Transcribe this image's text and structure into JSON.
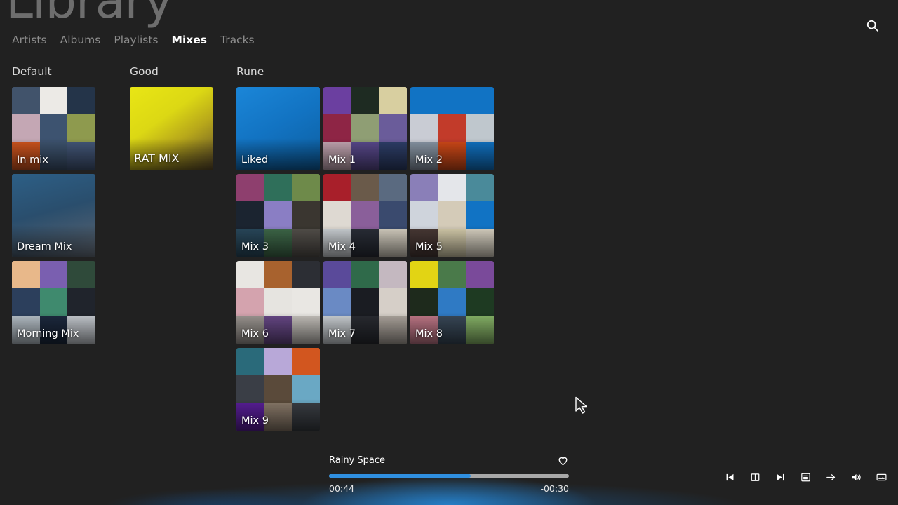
{
  "header": {
    "title": "Library",
    "search_icon": "search-icon",
    "tabs": [
      {
        "label": "Artists",
        "active": false
      },
      {
        "label": "Albums",
        "active": false
      },
      {
        "label": "Playlists",
        "active": false
      },
      {
        "label": "Mixes",
        "active": true
      },
      {
        "label": "Tracks",
        "active": false
      }
    ]
  },
  "sections": [
    {
      "name": "Default",
      "tiles": [
        {
          "label": "In mix",
          "kind": "collage",
          "cells": [
            "#41536b",
            "#eceae6",
            "#243449",
            "#c4a7b4",
            "#3d5370",
            "#8e9a4e",
            "#d2561f",
            "#3e5470",
            "#44587a"
          ]
        },
        {
          "label": "Dream Mix",
          "kind": "solid",
          "color": "#2b4f6e",
          "gradient": "linear-gradient(165deg,#2d5f86 0%,#2a4e6d 45%,#4a5c6e 78%,#6b7480 100%)"
        },
        {
          "label": "Morning Mix",
          "kind": "collage",
          "cells": [
            "#e8b88a",
            "#7a5fb0",
            "#2f4a3a",
            "#2c3f5c",
            "#3f8a6e",
            "#20242c",
            "#b9c3cb",
            "#1d2a40",
            "#c9ced4"
          ]
        }
      ]
    },
    {
      "name": "Good",
      "tiles": [
        {
          "label": "RAT MIX",
          "kind": "solid",
          "color": "#e3e018",
          "gradient": "linear-gradient(145deg,#e9e615 0%,#dcd814 38%,#b8a81a 62%,#5c4a2a 100%)"
        }
      ]
    },
    {
      "name": "Rune",
      "tiles": [
        {
          "label": "Liked",
          "kind": "solid",
          "color": "#1173c4",
          "gradient": "linear-gradient(150deg,#1b86d8 0%,#1273c2 48%,#0d5e9f 100%)"
        },
        {
          "label": "Mix 1",
          "kind": "collage",
          "cells": [
            "#6b3fa0",
            "#1e2b22",
            "#d8cfa0",
            "#8e2545",
            "#8f9e74",
            "#6a5c9a",
            "#c6a8b4",
            "#5a4a8e",
            "#2e3f6a"
          ]
        },
        {
          "label": "Mix 2",
          "kind": "collage",
          "cells": [
            "#1173c4",
            "#1173c4",
            "#1173c4",
            "#c9ccd4",
            "#c23b2a",
            "#bfc7cd",
            "#8a97a6",
            "#d24a18",
            "#1173c4"
          ]
        },
        {
          "label": "Mix 3",
          "kind": "collage",
          "cells": [
            "#8e3f6e",
            "#2f6f5a",
            "#6e8a4a",
            "#1b2430",
            "#8a7ec4",
            "#3a3630",
            "#2a4a5e",
            "#3f6a4a",
            "#55514c"
          ]
        },
        {
          "label": "Mix 4",
          "kind": "collage",
          "cells": [
            "#a81f2a",
            "#6a5a4a",
            "#5a6a80",
            "#ded9d2",
            "#8a5f9a",
            "#3a4a6e",
            "#cfd4d8",
            "#2a2e38",
            "#d8d2c4"
          ]
        },
        {
          "label": "Mix 5",
          "kind": "collage",
          "cells": [
            "#8a7fb8",
            "#e4e6ea",
            "#4a8a9a",
            "#cfd4dc",
            "#d4cbb8",
            "#1173c4",
            "#4a3a36",
            "#d8cfae",
            "#ddd6c6"
          ]
        },
        {
          "label": "Mix 6",
          "kind": "collage",
          "cells": [
            "#e8e6e2",
            "#a8622e",
            "#2c2e34",
            "#d4a3ae",
            "#e6e4e0",
            "#e9e7e3",
            "#a09a94",
            "#6a4a8a",
            "#c8c4be"
          ]
        },
        {
          "label": "Mix 7",
          "kind": "collage",
          "cells": [
            "#5a4a9a",
            "#2f6a4a",
            "#c4b8c0",
            "#6a8ac4",
            "#1a1c22",
            "#d6cfc8",
            "#cfd4d8",
            "#2a2c32",
            "#b0a8a0"
          ]
        },
        {
          "label": "Mix 8",
          "kind": "collage",
          "cells": [
            "#e2d414",
            "#4a7a4a",
            "#7a4a9a",
            "#1e2a1c",
            "#2f7ac4",
            "#1e3a22",
            "#c47a8a",
            "#3a4a5a",
            "#8ab86a"
          ]
        },
        {
          "label": "Mix 9",
          "kind": "collage",
          "cells": [
            "#2a6a7a",
            "#b8a8d8",
            "#d2561f",
            "#3a3e46",
            "#5a4a3a",
            "#6aa8c4",
            "#5a1f9a",
            "#8a7a6a",
            "#3a3e44"
          ]
        }
      ]
    }
  ],
  "player": {
    "track_title": "Rainy Space",
    "elapsed": "00:44",
    "remaining": "-00:30",
    "progress_percent": 59,
    "fill_color": "#2f8fe0",
    "track_color": "#a8a8a8",
    "favorite_icon": "heart-outline-icon",
    "favorited": false,
    "controls": [
      {
        "name": "previous-track-button",
        "icon": "skip-previous-icon"
      },
      {
        "name": "pause-button",
        "icon": "pause-icon"
      },
      {
        "name": "next-track-button",
        "icon": "skip-next-icon"
      },
      {
        "name": "queue-button",
        "icon": "queue-list-icon"
      },
      {
        "name": "goto-track-button",
        "icon": "arrow-right-icon"
      },
      {
        "name": "volume-button",
        "icon": "volume-icon"
      },
      {
        "name": "cover-art-button",
        "icon": "image-icon"
      }
    ]
  }
}
